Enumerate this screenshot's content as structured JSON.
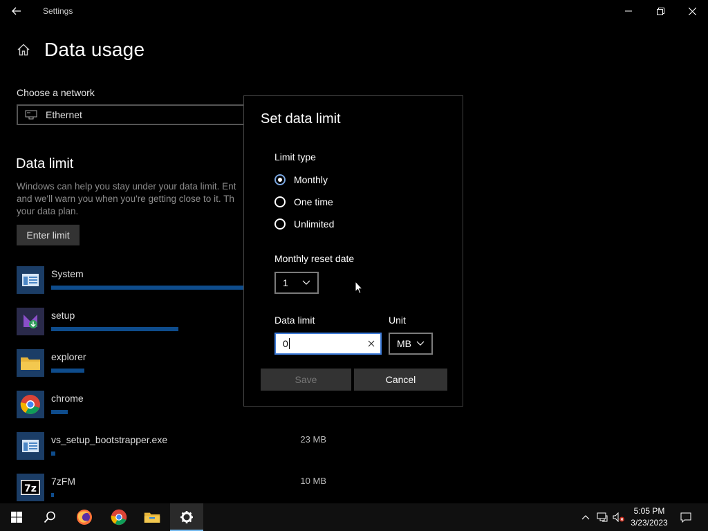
{
  "window": {
    "app_title": "Settings",
    "page_title": "Data usage"
  },
  "network": {
    "label": "Choose a network",
    "selected": "Ethernet"
  },
  "data_limit_section": {
    "title": "Data limit",
    "description": "Windows can help you stay under your data limit. Ent and we'll warn you when you're getting close to it. Th your data plan.",
    "enter_limit_label": "Enter limit"
  },
  "usage": [
    {
      "name": "System",
      "size": "",
      "fraction": 0.75,
      "icon": "app-window-icon"
    },
    {
      "name": "setup",
      "size": "",
      "fraction": 0.46,
      "icon": "setup-installer-icon"
    },
    {
      "name": "explorer",
      "size": "",
      "fraction": 0.12,
      "icon": "folder-icon"
    },
    {
      "name": "chrome",
      "size": "",
      "fraction": 0.06,
      "icon": "chrome-icon"
    },
    {
      "name": "vs_setup_bootstrapper.exe",
      "size": "23 MB",
      "fraction": 0.015,
      "icon": "app-window-icon"
    },
    {
      "name": "7zFM",
      "size": "10 MB",
      "fraction": 0.006,
      "icon": "7zip-icon"
    }
  ],
  "dialog": {
    "title": "Set data limit",
    "limit_type_label": "Limit type",
    "limit_types": [
      {
        "label": "Monthly",
        "checked": true
      },
      {
        "label": "One time",
        "checked": false
      },
      {
        "label": "Unlimited",
        "checked": false
      }
    ],
    "reset_date_label": "Monthly reset date",
    "reset_date_value": "1",
    "data_limit_label": "Data limit",
    "data_limit_value": "0",
    "unit_label": "Unit",
    "unit_value": "MB",
    "save_label": "Save",
    "cancel_label": "Cancel"
  },
  "taskbar": {
    "apps": [
      "start-icon",
      "search-icon",
      "firefox-icon",
      "chrome-icon",
      "file-explorer-icon",
      "settings-gear-icon"
    ],
    "active_app": "settings-gear-icon",
    "time": "5:05 PM",
    "date": "3/23/2023"
  },
  "colors": {
    "accent": "#0e4c8c",
    "focus_border": "#3d7bd9",
    "active_indicator": "#76b9ed"
  }
}
